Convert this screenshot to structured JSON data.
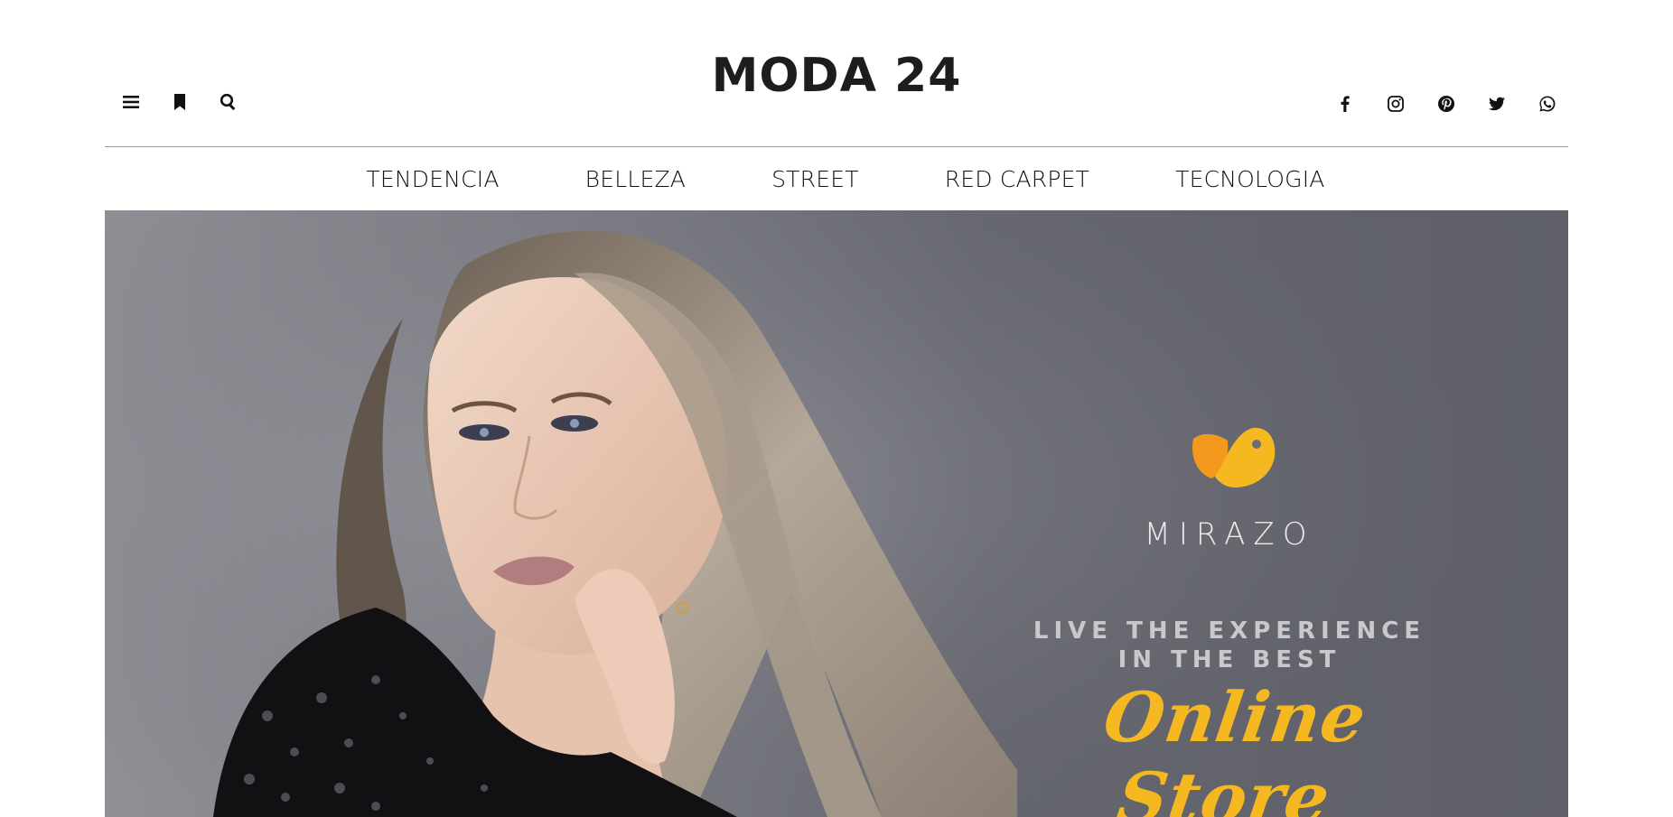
{
  "header": {
    "site_title": "MODA 24",
    "left_icons": [
      "menu-icon",
      "bookmark-icon",
      "search-icon"
    ],
    "social_icons": [
      "facebook-icon",
      "instagram-icon",
      "pinterest-icon",
      "twitter-icon",
      "whatsapp-icon"
    ]
  },
  "nav": {
    "items": [
      {
        "label": "TENDENCIA"
      },
      {
        "label": "BELLEZA"
      },
      {
        "label": "STREET"
      },
      {
        "label": "RED CARPET"
      },
      {
        "label": "TECNOLOGIA"
      }
    ]
  },
  "hero": {
    "brand_name": "MIRAZO",
    "tagline_line1": "LIVE THE EXPERIENCE",
    "tagline_line2": "IN THE BEST",
    "tagline_script": "Online Store",
    "colors": {
      "background": "#6b6c74",
      "accent_yellow": "#f5b820",
      "accent_orange": "#f39a1e",
      "text_light": "#ececec"
    }
  }
}
